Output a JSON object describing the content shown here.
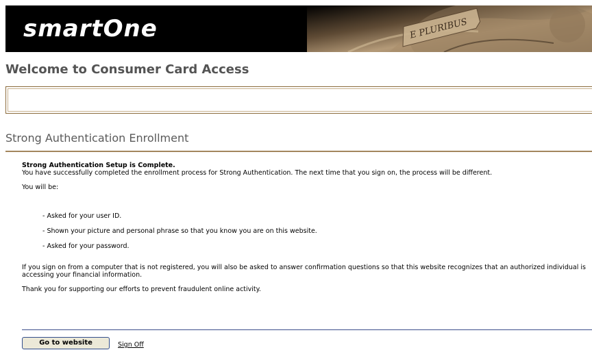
{
  "header": {
    "logo_text": "smartOne",
    "art_text": "E PLURIBUS"
  },
  "welcome_title": "Welcome to Consumer Card Access",
  "section": {
    "title": "Strong Authentication Enrollment"
  },
  "content": {
    "heading": "Strong Authentication Setup is Complete.",
    "para1": "You have successfully completed the enrollment process for Strong Authentication. The next time that you sign on, the process will be different.",
    "para2": "You will be:",
    "bullets": [
      "- Asked for your user ID.",
      "- Shown your picture and personal phrase so that you know you are on this website.",
      "- Asked for your password."
    ],
    "para3": "If you sign on from a computer that is not registered, you will also be asked to answer confirmation questions so that this website recognizes that an authorized individual is accessing your financial information.",
    "para4": "Thank you for supporting our efforts to prevent fraudulent online activity."
  },
  "actions": {
    "go_label": "Go to website",
    "signoff_label": "Sign Off"
  },
  "colors": {
    "banner": "#000000",
    "accent_rule": "#a3865d",
    "button_border": "#334e8c"
  }
}
